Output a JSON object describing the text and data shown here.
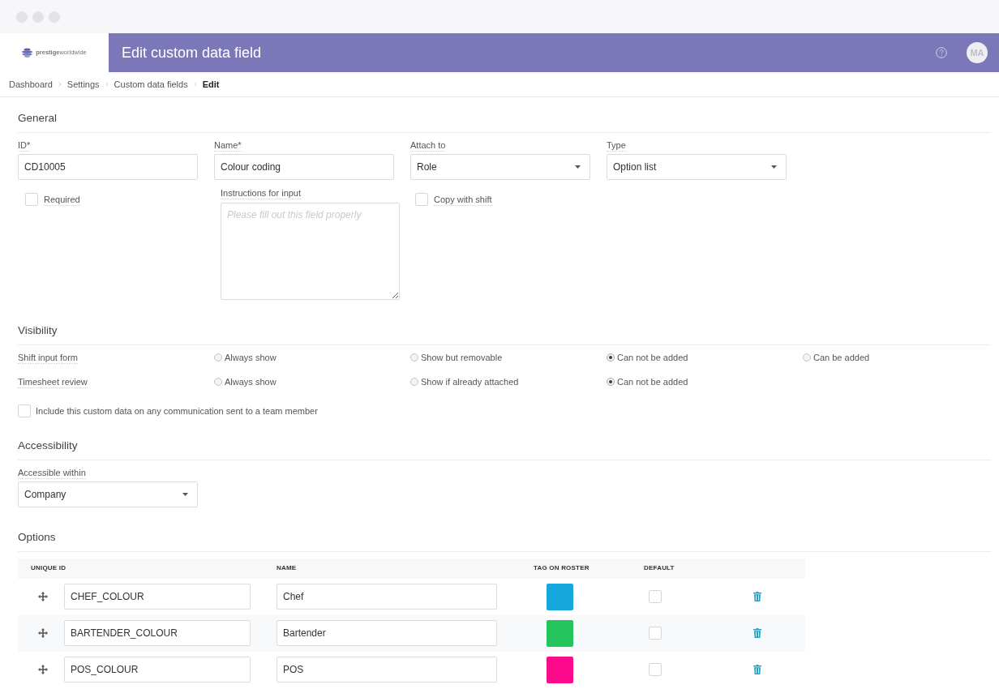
{
  "header": {
    "logo_text": "**prestige**worldwide",
    "title": "Edit custom data field",
    "avatar_initials": "MA"
  },
  "breadcrumb": [
    {
      "label": "Dashboard",
      "current": false
    },
    {
      "label": "Settings",
      "current": false
    },
    {
      "label": "Custom data fields",
      "current": false
    },
    {
      "label": "Edit",
      "current": true
    }
  ],
  "general": {
    "heading": "General",
    "fields": [
      {
        "label": "ID*",
        "kind": "text",
        "value": "CD10005"
      },
      {
        "label": "Name*",
        "kind": "text",
        "value": "Colour coding"
      },
      {
        "label": "Attach to",
        "kind": "select",
        "value": "Role"
      },
      {
        "label": "Type",
        "kind": "select",
        "value": "Option list"
      }
    ],
    "required": {
      "label": "Required",
      "checked": false
    },
    "instructions": {
      "label": "Instructions for input",
      "placeholder": "Please fill out this field properly"
    },
    "copy_with_shift": {
      "label": "Copy with shift",
      "checked": false
    }
  },
  "visibility": {
    "heading": "Visibility",
    "rows": [
      {
        "label": "Shift input form",
        "options": [
          {
            "label": "Always show",
            "selected": false
          },
          {
            "label": "Show but removable",
            "selected": false
          },
          {
            "label": "Can not be added",
            "selected": true
          },
          {
            "label": "Can be added",
            "selected": false
          }
        ]
      },
      {
        "label": "Timesheet review",
        "options": [
          {
            "label": "Always show",
            "selected": false
          },
          {
            "label": "Show if already attached",
            "selected": false
          },
          {
            "label": "Can not be added",
            "selected": true
          }
        ]
      }
    ],
    "include_communication": {
      "label": "Include this custom data on any communication sent to a team member",
      "checked": false
    }
  },
  "accessibility": {
    "heading": "Accessibility",
    "field": {
      "label": "Accessible within",
      "value": "Company"
    }
  },
  "options": {
    "heading": "Options",
    "columns": [
      "UNIQUE ID",
      "NAME",
      "TAG ON ROSTER",
      "DEFAULT"
    ],
    "rows": [
      {
        "unique_id": "CHEF_COLOUR",
        "name": "Chef",
        "color": "#15a6dc",
        "default": false
      },
      {
        "unique_id": "BARTENDER_COLOUR",
        "name": "Bartender",
        "color": "#24c55c",
        "default": false
      },
      {
        "unique_id": "POS_COLOUR",
        "name": "POS",
        "color": "#fc0a8c",
        "default": false
      }
    ]
  }
}
